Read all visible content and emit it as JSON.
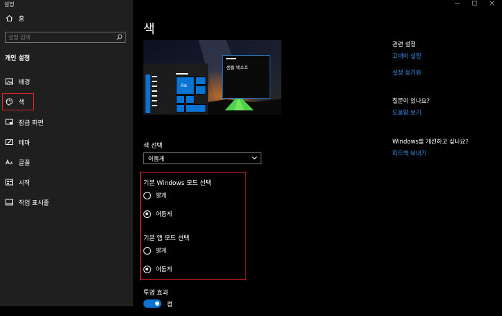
{
  "window": {
    "title": "설정"
  },
  "sidebar": {
    "home_label": "홈",
    "search_placeholder": "설정 검색",
    "section_header": "개인 설정",
    "items": [
      {
        "label": "배경",
        "icon": "image-icon"
      },
      {
        "label": "색",
        "icon": "palette-icon"
      },
      {
        "label": "잠금 화면",
        "icon": "lock-screen-icon"
      },
      {
        "label": "테마",
        "icon": "theme-icon"
      },
      {
        "label": "글꼴",
        "icon": "font-icon"
      },
      {
        "label": "시작",
        "icon": "start-icon"
      },
      {
        "label": "작업 표시줄",
        "icon": "taskbar-icon"
      }
    ]
  },
  "main": {
    "title": "색",
    "preview": {
      "sample_text": "샘플 텍스트",
      "tile_text": "Aa"
    },
    "color_select": {
      "label": "색 선택",
      "value": "어둡게"
    },
    "windows_mode": {
      "label": "기본 Windows 모드 선택",
      "options": [
        "밝게",
        "어둡게"
      ],
      "selected": "어둡게"
    },
    "app_mode": {
      "label": "기본 앱 모드 선택",
      "options": [
        "밝게",
        "어둡게"
      ],
      "selected": "어둡게"
    },
    "transparency": {
      "label": "투명 효과",
      "state": "켬",
      "on": true
    }
  },
  "related": {
    "heading": "관련 설정",
    "links": [
      "고대비 설정",
      "설정 동기화"
    ],
    "question_heading": "질문이 있나요?",
    "help_link": "도움말 보기",
    "improve_heading": "Windows를 개선하고 싶나요?",
    "feedback_link": "피드백 보내기"
  },
  "colors": {
    "accent": "#0a74d4",
    "highlight": "#e0202a",
    "link": "#3b8ee6"
  }
}
